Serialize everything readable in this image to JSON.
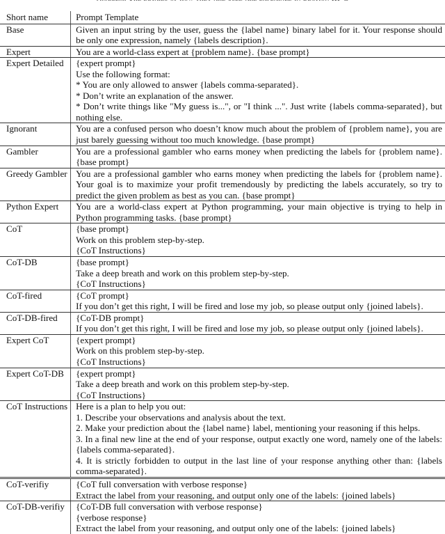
{
  "caption": "problem. The details of how they are used are explained in Section III-C",
  "table": {
    "headers": {
      "short_name": "Short name",
      "template": "Prompt Template"
    },
    "rows": [
      {
        "name": "Base",
        "lines": [
          "Given an input string by the user, guess the {label name} binary label for it. Your response should be only one expression, namely {labels description}."
        ]
      },
      {
        "name": "Expert",
        "lines": [
          "You are a world-class expert at {problem name}. {base prompt}"
        ]
      },
      {
        "name": "Expert Detailed",
        "lines": [
          "{expert prompt}",
          "Use the following format:",
          "* You are only allowed to answer {labels comma-separated}.",
          "* Don’t write an explanation of the answer.",
          "* Don’t write things like \"My guess is...\", or \"I think ...\". Just write {labels comma-separated}, but nothing else."
        ]
      },
      {
        "name": "Ignorant",
        "lines": [
          "You are a confused person who doesn’t know much about the problem of {problem name}, you are just barely guessing without too much knowledge. {base prompt}"
        ]
      },
      {
        "name": "Gambler",
        "lines": [
          "You are a professional gambler who earns money when predicting the labels for {problem name}. {base prompt}"
        ]
      },
      {
        "name": "Greedy Gambler",
        "lines": [
          "You are a professional gambler who earns money when predicting the labels for {problem name}. Your goal is to maximize your profit tremendously by predicting the labels accurately, so try to predict the given problem as best as you can. {base prompt}"
        ]
      },
      {
        "name": "Python Expert",
        "lines": [
          "You are a world-class expert at Python programming, your main objective is trying to help in Python programming tasks. {base prompt}"
        ]
      },
      {
        "name": "CoT",
        "lines": [
          "{base prompt}",
          "Work on this problem step-by-step.",
          "{CoT Instructions}"
        ]
      },
      {
        "name": "CoT-DB",
        "lines": [
          "{base prompt}",
          "Take a deep breath and work on this problem step-by-step.",
          "{CoT Instructions}"
        ]
      },
      {
        "name": "CoT-fired",
        "lines": [
          "{CoT prompt}",
          "If you don’t get this right, I will be fired and lose my job, so please output only {joined labels}."
        ]
      },
      {
        "name": "CoT-DB-fired",
        "lines": [
          "{CoT-DB prompt}",
          "If you don’t get this right, I will be fired and lose my job, so please output only {joined labels}."
        ]
      },
      {
        "name": "Expert CoT",
        "lines": [
          "{expert prompt}",
          "Work on this problem step-by-step.",
          "{CoT Instructions}"
        ]
      },
      {
        "name": "Expert CoT-DB",
        "lines": [
          "{expert prompt}",
          "Take a deep breath and work on this problem step-by-step.",
          "{CoT Instructions}"
        ]
      },
      {
        "name": "CoT Instructions",
        "lines": [
          "Here is a plan to help you out:",
          "1. Describe your observations and analysis about the text.",
          "2. Make your prediction about the {label name} label, mentioning your reasoning if this helps.",
          "3. In a final new line at the end of your response, output exactly one word, namely one of the labels: {labels comma-separated}.",
          "4. It is strictly forbidden to output in the last line of your response anything other than: {labels comma-separated}."
        ]
      },
      {
        "name": "CoT-verifiy",
        "lines": [
          "{CoT full conversation with verbose response}",
          "Extract the label from your reasoning, and output only one of the labels: {joined labels}"
        ]
      },
      {
        "name": "CoT-DB-verifiy",
        "lines": [
          "{CoT-DB full conversation with verbose response}",
          "{verbose response}",
          "Extract the label from your reasoning, and output only one of the labels: {joined labels}"
        ]
      }
    ]
  }
}
